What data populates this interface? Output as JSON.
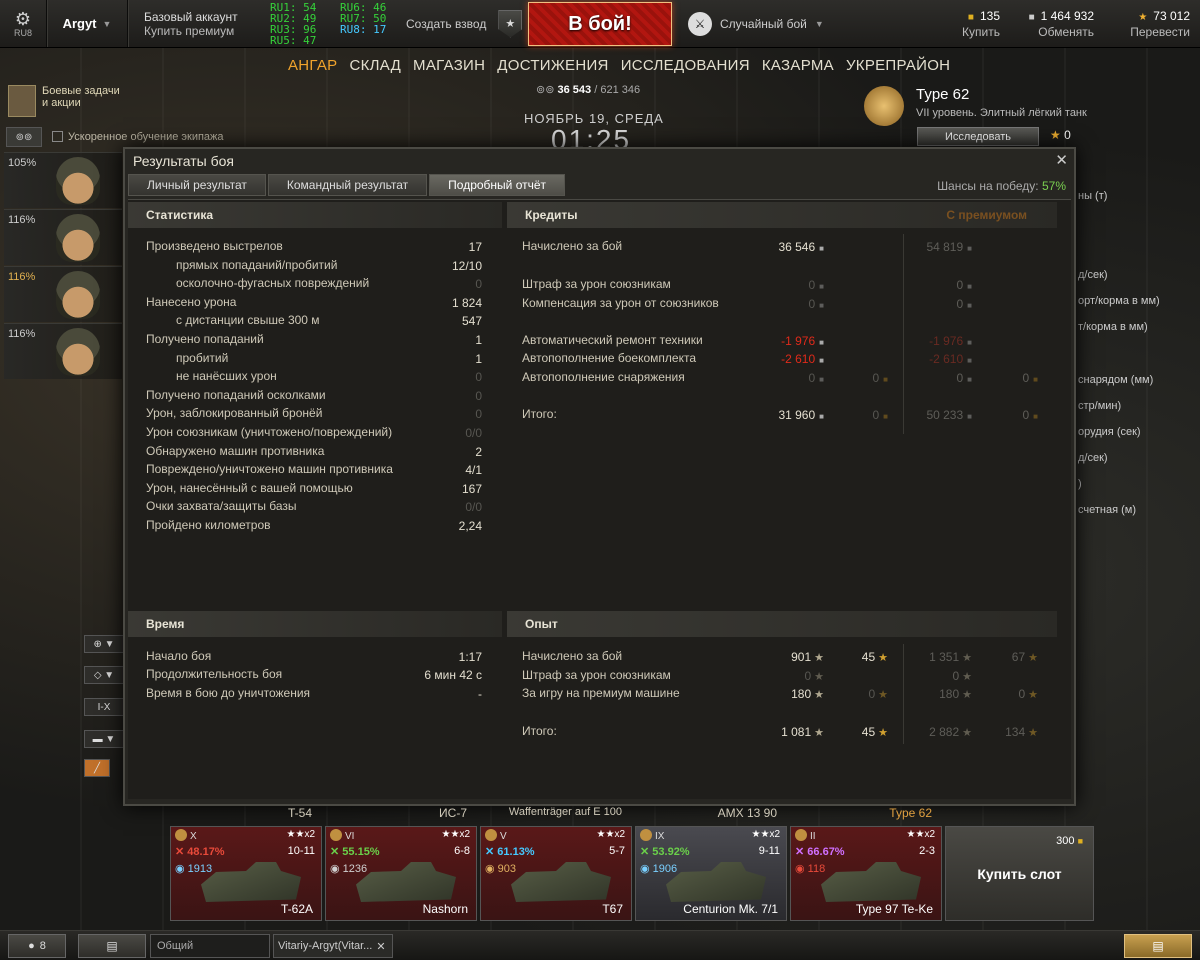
{
  "topbar": {
    "server": "RU8",
    "username": "Argyt",
    "account_type": "Базовый аккаунт",
    "buy_premium": "Купить премиум",
    "online": [
      "RU1: 54",
      "RU6: 46",
      "RU2: 49",
      "RU7: 50",
      "RU3: 96",
      "RU8: 17",
      "RU5: 47"
    ],
    "create_platoon": "Создать взвод",
    "battle_button": "В бой!",
    "battle_type": "Случайный бой",
    "gold": {
      "value": "135",
      "action": "Купить"
    },
    "credits": {
      "value": "1 464 932",
      "action": "Обменять"
    },
    "free_xp": {
      "value": "73 012",
      "action": "Перевести"
    }
  },
  "main_menu": [
    "АНГАР",
    "СКЛАД",
    "МАГАЗИН",
    "ДОСТИЖЕНИЯ",
    "ИССЛЕДОВАНИЯ",
    "КАЗАРМА",
    "УКРЕПРАЙОН"
  ],
  "hangar": {
    "exp_current": "36 543",
    "exp_total": "/ 621 346",
    "date": "НОЯБРЬ 19, СРЕДА",
    "time": "01:25",
    "missions_label": "Боевые задачи и акции",
    "accelerated_training": "Ускоренное обучение экипажа",
    "crew": [
      "105%",
      "116%",
      "116%",
      "116%"
    ]
  },
  "tank": {
    "name": "Type 62",
    "description": "VII уровень. Элитный лёгкий танк",
    "research_button": "Исследовать",
    "xp": "0",
    "param_fragments": [
      "ны (т)",
      "д/сек)",
      "орт/корма в мм)",
      "т/корма в мм)",
      "снарядом (мм)",
      "стр/мин)",
      "орудия (сек)",
      "д/сек)",
      ")",
      "счетная (м)"
    ]
  },
  "dialog": {
    "title": "Результаты боя",
    "tabs": [
      "Личный результат",
      "Командный результат",
      "Подробный отчёт"
    ],
    "win_chance_label": "Шансы на победу:",
    "win_chance_value": "57%",
    "stats": {
      "header": "Статистика",
      "rows": [
        {
          "label": "Произведено выстрелов",
          "value": "17"
        },
        {
          "label": "прямых попаданий/пробитий",
          "value": "12/10"
        },
        {
          "label": "осколочно-фугасных повреждений",
          "value": "0"
        },
        {
          "label": "Нанесено урона",
          "value": "1 824"
        },
        {
          "label": "с дистанции свыше 300 м",
          "value": "547"
        },
        {
          "label": "Получено попаданий",
          "value": "1"
        },
        {
          "label": "пробитий",
          "value": "1"
        },
        {
          "label": "не нанёсших урон",
          "value": "0"
        },
        {
          "label": "Получено попаданий осколками",
          "value": "0"
        },
        {
          "label": "Урон, заблокированный бронёй",
          "value": "0"
        },
        {
          "label": "Урон союзникам (уничтожено/повреждений)",
          "value": "0/0"
        },
        {
          "label": "Обнаружено машин противника",
          "value": "2"
        },
        {
          "label": "Повреждено/уничтожено машин противника",
          "value": "4/1"
        },
        {
          "label": "Урон, нанесённый с вашей помощью",
          "value": "167"
        },
        {
          "label": "Очки захвата/защиты базы",
          "value": "0/0"
        },
        {
          "label": "Пройдено километров",
          "value": "2,24"
        }
      ]
    },
    "credits": {
      "header": "Кредиты",
      "premium_header": "С премиумом",
      "earned": {
        "label": "Начислено за бой",
        "value": "36 546",
        "prem": "54 819"
      },
      "ally_fine": {
        "label": "Штраф за урон союзникам",
        "value": "0",
        "prem": "0"
      },
      "ally_comp": {
        "label": "Компенсация за урон от союзников",
        "value": "0",
        "prem": "0"
      },
      "repair": {
        "label": "Автоматический ремонт техники",
        "value": "-1 976",
        "prem": "-1 976"
      },
      "ammo": {
        "label": "Автопополнение боекомплекта",
        "value": "-2 610",
        "prem": "-2 610"
      },
      "equip": {
        "label": "Автопополнение снаряжения",
        "value": "0",
        "gold": "0",
        "prem": "0",
        "prem_gold": "0"
      },
      "total": {
        "label": "Итого:",
        "value": "31 960",
        "gold": "0",
        "prem": "50 233",
        "prem_gold": "0"
      }
    },
    "time": {
      "header": "Время",
      "rows": [
        {
          "label": "Начало боя",
          "value": "1:17"
        },
        {
          "label": "Продолжительность боя",
          "value": "6 мин 42 с"
        },
        {
          "label": "Время в бою до уничтожения",
          "value": "-"
        }
      ]
    },
    "experience": {
      "header": "Опыт",
      "earned": {
        "label": "Начислено за бой",
        "xp": "901",
        "free": "45",
        "prem_xp": "1 351",
        "prem_free": "67"
      },
      "fine": {
        "label": "Штраф за урон союзникам",
        "xp": "0",
        "prem_xp": "0"
      },
      "premium_tank": {
        "label": "За игру на премиум машине",
        "xp": "180",
        "free": "0",
        "prem_xp": "180",
        "prem_free": "0"
      },
      "total": {
        "label": "Итого:",
        "xp": "1 081",
        "free": "45",
        "prem_xp": "2 882",
        "prem_free": "134"
      }
    }
  },
  "carousel_top_labels": [
    "T-54",
    "ИС-7",
    "Waffenträger auf E 100",
    "AMX 13 90",
    "Type 62"
  ],
  "carousel": [
    {
      "tier": "X",
      "x2": "x2",
      "winrate": "48.17%",
      "battles_level": "10-11",
      "count": "1913",
      "name": "T-62A",
      "wr_color": "#e84a3a",
      "cnt_color": "#7ad0ff"
    },
    {
      "tier": "VI",
      "x2": "x2",
      "winrate": "55.15%",
      "battles_level": "6-8",
      "count": "1236",
      "name": "Nashorn",
      "wr_color": "#6ad04a",
      "cnt_color": "#d0d0d0"
    },
    {
      "tier": "V",
      "x2": "x2",
      "winrate": "61.13%",
      "battles_level": "5-7",
      "count": "903",
      "name": "T67",
      "wr_color": "#45c9ff",
      "cnt_color": "#e0b060"
    },
    {
      "tier": "IX",
      "x2": "x2",
      "winrate": "53.92%",
      "battles_level": "9-11",
      "count": "1906",
      "name": "Centurion Mk. 7/1",
      "wr_color": "#6ad04a",
      "cnt_color": "#7ad0ff"
    },
    {
      "tier": "II",
      "x2": "x2",
      "winrate": "66.67%",
      "battles_level": "2-3",
      "count": "118",
      "name": "Type 97 Te-Ke",
      "wr_color": "#d070ff",
      "cnt_color": "#e84a3a"
    }
  ],
  "buy_slot": {
    "label": "Купить слот",
    "price": "300"
  },
  "filters": [
    "I-X"
  ],
  "bottombar": {
    "contacts_count": "8",
    "channel_common": "Общий",
    "channel_private": "Vitariy-Argyt(Vitar..."
  }
}
